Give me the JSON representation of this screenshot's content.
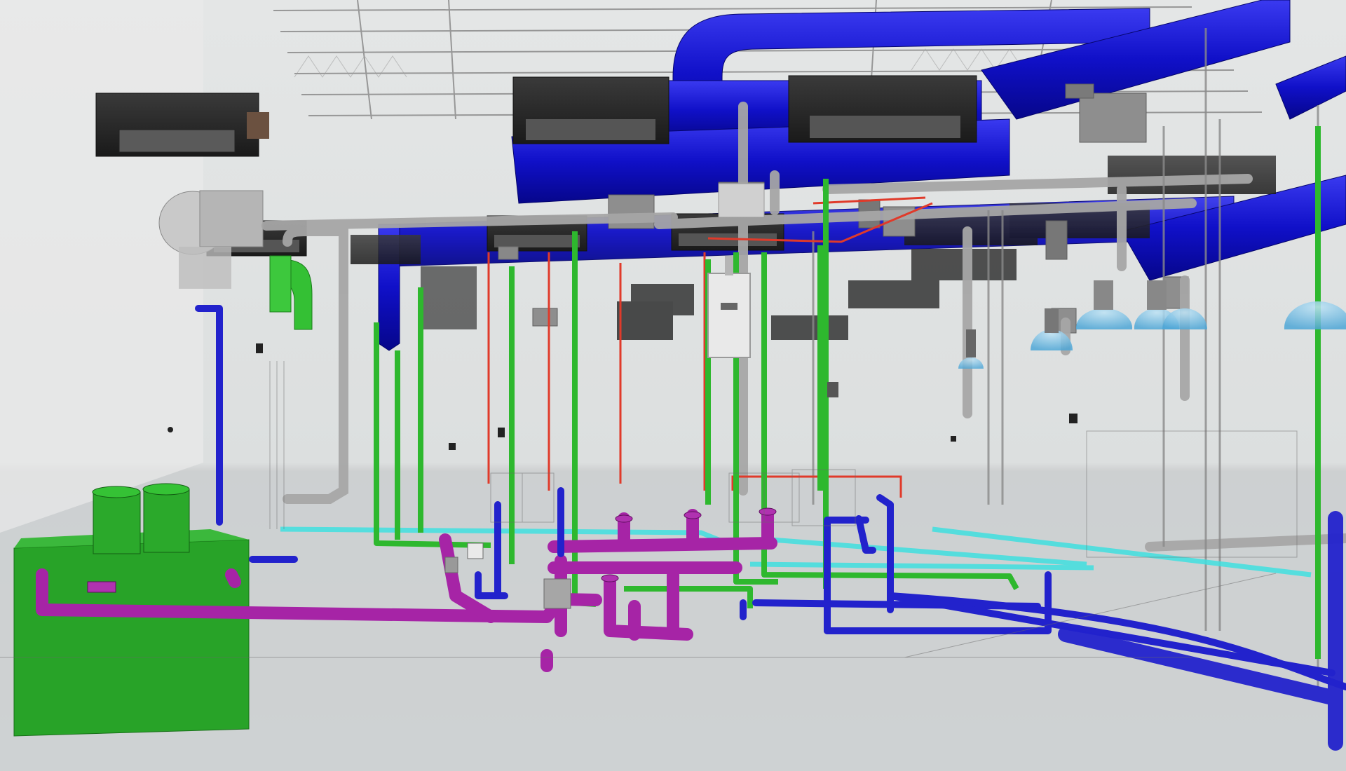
{
  "scene": {
    "kind": "3D MEP model view",
    "colors": {
      "hvac_duct": "#1212d8",
      "cold_water": "#2eb82e",
      "hot_water": "#e03a2a",
      "sanitary_waste": "#a624a6",
      "storm_vent": "#2222cc",
      "gas_line": "#3fe0e0",
      "grey_pipe": "#a8a8a8",
      "equipment_dark": "#2b2b2b",
      "tank_green": "#1fa11f",
      "wall_tint": "#dfe4e4",
      "floor_tint": "#cfd2d3"
    },
    "icons": [
      "ceiling-heater-icon",
      "water-heater-icon",
      "pendant-lamp-icon",
      "fan-blower-icon",
      "interceptor-tank-icon"
    ]
  }
}
